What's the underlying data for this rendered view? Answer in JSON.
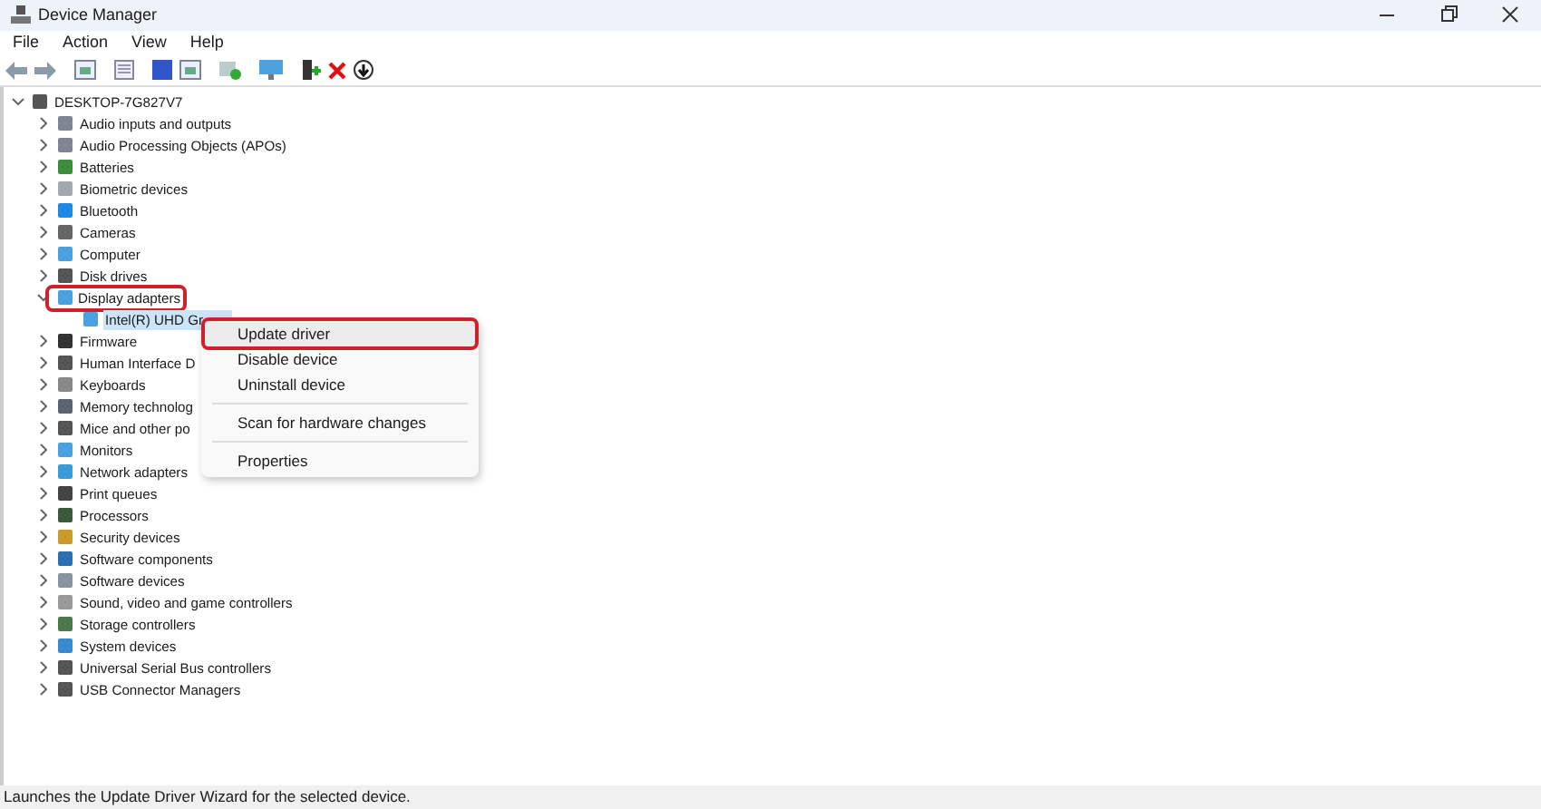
{
  "window": {
    "title": "Device Manager"
  },
  "menu_bar": [
    "File",
    "Action",
    "View",
    "Help"
  ],
  "tree": {
    "label": "DESKTOP-7G827V7",
    "expanded": true,
    "children": [
      {
        "label": "Audio inputs and outputs",
        "expanded": false
      },
      {
        "label": "Audio Processing Objects (APOs)",
        "expanded": false
      },
      {
        "label": "Batteries",
        "expanded": false
      },
      {
        "label": "Biometric devices",
        "expanded": false
      },
      {
        "label": "Bluetooth",
        "expanded": false
      },
      {
        "label": "Cameras",
        "expanded": false
      },
      {
        "label": "Computer",
        "expanded": false
      },
      {
        "label": "Disk drives",
        "expanded": false
      },
      {
        "label": "Display adapters",
        "expanded": true,
        "highlighted": true,
        "children": [
          {
            "label": "Intel(R) UHD Gr",
            "selected": true
          }
        ]
      },
      {
        "label": "Firmware",
        "expanded": false
      },
      {
        "label": "Human Interface D",
        "expanded": false
      },
      {
        "label": "Keyboards",
        "expanded": false
      },
      {
        "label": "Memory technolog",
        "expanded": false
      },
      {
        "label": "Mice and other po",
        "expanded": false
      },
      {
        "label": "Monitors",
        "expanded": false
      },
      {
        "label": "Network adapters",
        "expanded": false
      },
      {
        "label": "Print queues",
        "expanded": false
      },
      {
        "label": "Processors",
        "expanded": false
      },
      {
        "label": "Security devices",
        "expanded": false
      },
      {
        "label": "Software components",
        "expanded": false
      },
      {
        "label": "Software devices",
        "expanded": false
      },
      {
        "label": "Sound, video and game controllers",
        "expanded": false
      },
      {
        "label": "Storage controllers",
        "expanded": false
      },
      {
        "label": "System devices",
        "expanded": false
      },
      {
        "label": "Universal Serial Bus controllers",
        "expanded": false
      },
      {
        "label": "USB Connector Managers",
        "expanded": false
      }
    ]
  },
  "context_menu": {
    "groups": [
      [
        {
          "label": "Update driver",
          "highlighted": true
        },
        {
          "label": "Disable device",
          "highlighted": false
        },
        {
          "label": "Uninstall device",
          "highlighted": false
        }
      ],
      [
        {
          "label": "Scan for hardware changes",
          "highlighted": false
        }
      ],
      [
        {
          "label": "Properties",
          "highlighted": false
        }
      ]
    ]
  },
  "status_bar": "Launches the Update Driver Wizard for the selected device."
}
